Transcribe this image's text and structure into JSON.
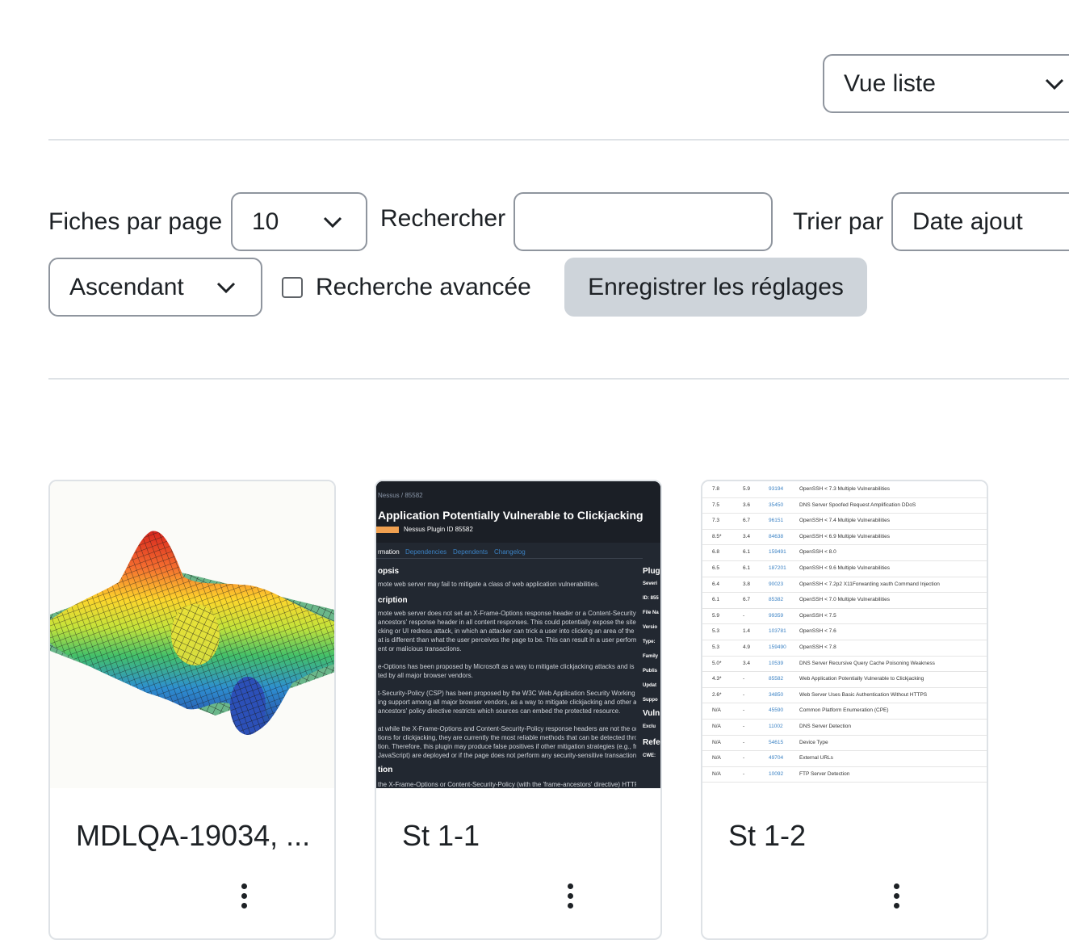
{
  "view_select": {
    "value": "Vue liste"
  },
  "settings": {
    "per_page_label": "Fiches par page",
    "per_page_value": "10",
    "search_label": "Rechercher",
    "search_value": "",
    "sort_label": "Trier par",
    "sort_value": "Date ajout",
    "order_value": "Ascendant",
    "advanced_search_label": "Recherche avancée",
    "advanced_search_checked": false,
    "save_button_label": "Enregistrer les réglages"
  },
  "cards": [
    {
      "title": "MDLQA-19034, ...",
      "thumbnail": "3d-surface-plot"
    },
    {
      "title": "St 1-1",
      "thumbnail": "nessus-plugin-screenshot"
    },
    {
      "title": "St 1-2",
      "thumbnail": "vulnerability-table-screenshot"
    }
  ],
  "thumb2": {
    "breadcrumb": "Nessus / 85582",
    "title": "Application Potentially Vulnerable to Clickjacking",
    "plugin_id": "Nessus Plugin ID 85582",
    "tabs": [
      "rmation",
      "Dependencies",
      "Dependents",
      "Changelog"
    ],
    "synopsis_head": "opsis",
    "synopsis": "mote web server may fail to mitigate a class of web application vulnerabilities.",
    "description_head": "cription",
    "description_lines": [
      "mote web server does not set an X-Frame-Options response header or a Content-Security-Policy",
      "ancestors' response header in all content responses. This could potentially expose the site to a",
      "cking or UI redress attack, in which an attacker can trick a user into clicking an area of the vulnerable",
      "at is different than what the user perceives the page to be. This can result in a user performing",
      "ent or malicious transactions.",
      "",
      "e-Options has been proposed by Microsoft as a way to mitigate clickjacking attacks and is currently",
      "ted by all major browser vendors.",
      "",
      "t-Security-Policy (CSP) has been proposed by the W3C Web Application Security Working Group, with",
      "ing support among all major browser vendors, as a way to mitigate clickjacking and other attacks. The",
      "ancestors' policy directive restricts which sources can embed the protected resource.",
      "",
      "at while the X-Frame-Options and Content-Security-Policy response headers are not the only",
      "tions for clickjacking, they are currently the most reliable methods that can be detected through",
      "tion. Therefore, this plugin may produce false positives if other mitigation strategies (e.g., frame-",
      " JavaScript) are deployed or if the page does not perform any security-sensitive transactions."
    ],
    "solution_head": "tion",
    "solution_line": "the X-Frame-Options or Content-Security-Policy (with the 'frame-ancestors' directive) HTTP header",
    "side_head1": "Plug",
    "side_items": [
      "Severi",
      "ID: 855",
      "File Na",
      "Versio",
      "Type:",
      "Family",
      "Publis",
      "Updat",
      "Suppo"
    ],
    "side_head2": "Vuln",
    "side_item2": "Exclu",
    "side_head3": "Refe",
    "side_item3": "CWE:"
  },
  "thumb3": {
    "rows": [
      [
        "7.8",
        "5.9",
        "93194",
        "OpenSSH < 7.3 Multiple Vulnerabilities"
      ],
      [
        "7.5",
        "3.6",
        "35450",
        "DNS Server Spoofed Request Amplification DDoS"
      ],
      [
        "7.3",
        "6.7",
        "96151",
        "OpenSSH < 7.4 Multiple Vulnerabilities"
      ],
      [
        "8.5*",
        "3.4",
        "84638",
        "OpenSSH < 6.9 Multiple Vulnerabilities"
      ],
      [
        "6.8",
        "6.1",
        "159491",
        "OpenSSH < 8.0"
      ],
      [
        "6.5",
        "6.1",
        "187201",
        "OpenSSH < 9.6 Multiple Vulnerabilities"
      ],
      [
        "6.4",
        "3.8",
        "90023",
        "OpenSSH < 7.2p2 X11Forwarding xauth Command Injection"
      ],
      [
        "6.1",
        "6.7",
        "85382",
        "OpenSSH < 7.0 Multiple Vulnerabilities"
      ],
      [
        "5.9",
        "-",
        "99359",
        "OpenSSH < 7.5"
      ],
      [
        "5.3",
        "1.4",
        "103781",
        "OpenSSH < 7.6"
      ],
      [
        "5.3",
        "4.9",
        "159490",
        "OpenSSH < 7.8"
      ],
      [
        "5.0*",
        "3.4",
        "10539",
        "DNS Server Recursive Query Cache Poisoning Weakness"
      ],
      [
        "4.3*",
        "-",
        "85582",
        "Web Application Potentially Vulnerable to Clickjacking"
      ],
      [
        "2.6*",
        "-",
        "34850",
        "Web Server Uses Basic Authentication Without HTTPS"
      ],
      [
        "N/A",
        "-",
        "45590",
        "Common Platform Enumeration (CPE)"
      ],
      [
        "N/A",
        "-",
        "11002",
        "DNS Server Detection"
      ],
      [
        "N/A",
        "-",
        "54615",
        "Device Type"
      ],
      [
        "N/A",
        "-",
        "49704",
        "External URLs"
      ],
      [
        "N/A",
        "-",
        "10092",
        "FTP Server Detection"
      ]
    ]
  },
  "colors": {
    "button_bg": "#ced4da",
    "border": "#8f959e",
    "divider": "#dee2e6",
    "thumb2_bg": "#222831",
    "accent_orange": "#f0a050",
    "link_blue": "#3b82c4"
  }
}
